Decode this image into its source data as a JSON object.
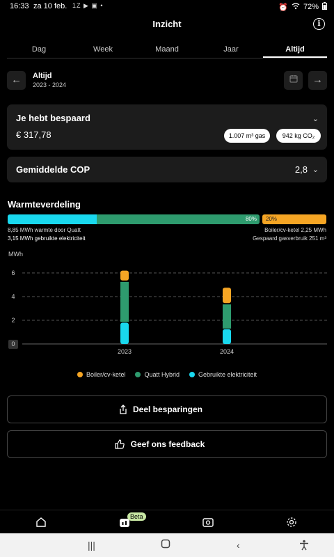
{
  "status": {
    "time": "16:33",
    "date": "za 10 feb.",
    "notif": "1Z ▶ ▣ •",
    "battery": "72%"
  },
  "header": {
    "title": "Inzicht"
  },
  "tabs": [
    "Dag",
    "Week",
    "Maand",
    "Jaar",
    "Altijd"
  ],
  "active_tab": "Altijd",
  "period": {
    "title": "Altijd",
    "range": "2023 - 2024"
  },
  "savings": {
    "title": "Je hebt bespaard",
    "amount": "€ 317,78",
    "gas_value": "1.007 m³ gas",
    "co2_value": "942 kg CO₂"
  },
  "cop": {
    "title": "Gemiddelde COP",
    "value": "2,8"
  },
  "warmte": {
    "title": "Warmteverdeling",
    "hybrid_pct": "80%",
    "boiler_pct": "20%",
    "elec_share": 0.28,
    "hybrid_share": 0.52,
    "boiler_share": 0.2,
    "left_line1": "8,85 MWh warmte door Quatt",
    "left_line2": "3,15 MWh gebruikte elektriciteit",
    "right_line1": "Boiler/cv-ketel 2,25 MWh",
    "right_line2": "Gespaard gasverbruik 251 m³"
  },
  "chart_data": {
    "type": "bar",
    "stacked": true,
    "ylabel": "MWh",
    "categories": [
      "2023",
      "2024"
    ],
    "yticks": [
      "0",
      "2",
      "4",
      "6"
    ],
    "ylim": [
      0,
      7
    ],
    "series": [
      {
        "name": "Gebruikte elektriciteit",
        "color": "#19d8ee",
        "values": [
          1.85,
          1.3
        ]
      },
      {
        "name": "Quatt Hybrid",
        "color": "#2e9b6e",
        "values": [
          3.45,
          2.1
        ]
      },
      {
        "name": "Boiler/cv-ketel",
        "color": "#f5a524",
        "values": [
          0.9,
          1.35
        ]
      }
    ],
    "legend": [
      "Boiler/cv-ketel",
      "Quatt Hybrid",
      "Gebruikte elektriciteit"
    ]
  },
  "buttons": {
    "share": "Deel besparingen",
    "feedback": "Geef ons feedback"
  },
  "nav": {
    "beta": "Beta"
  },
  "colors": {
    "elec": "#19d8ee",
    "hybrid": "#2e9b6e",
    "boiler": "#f5a524"
  }
}
